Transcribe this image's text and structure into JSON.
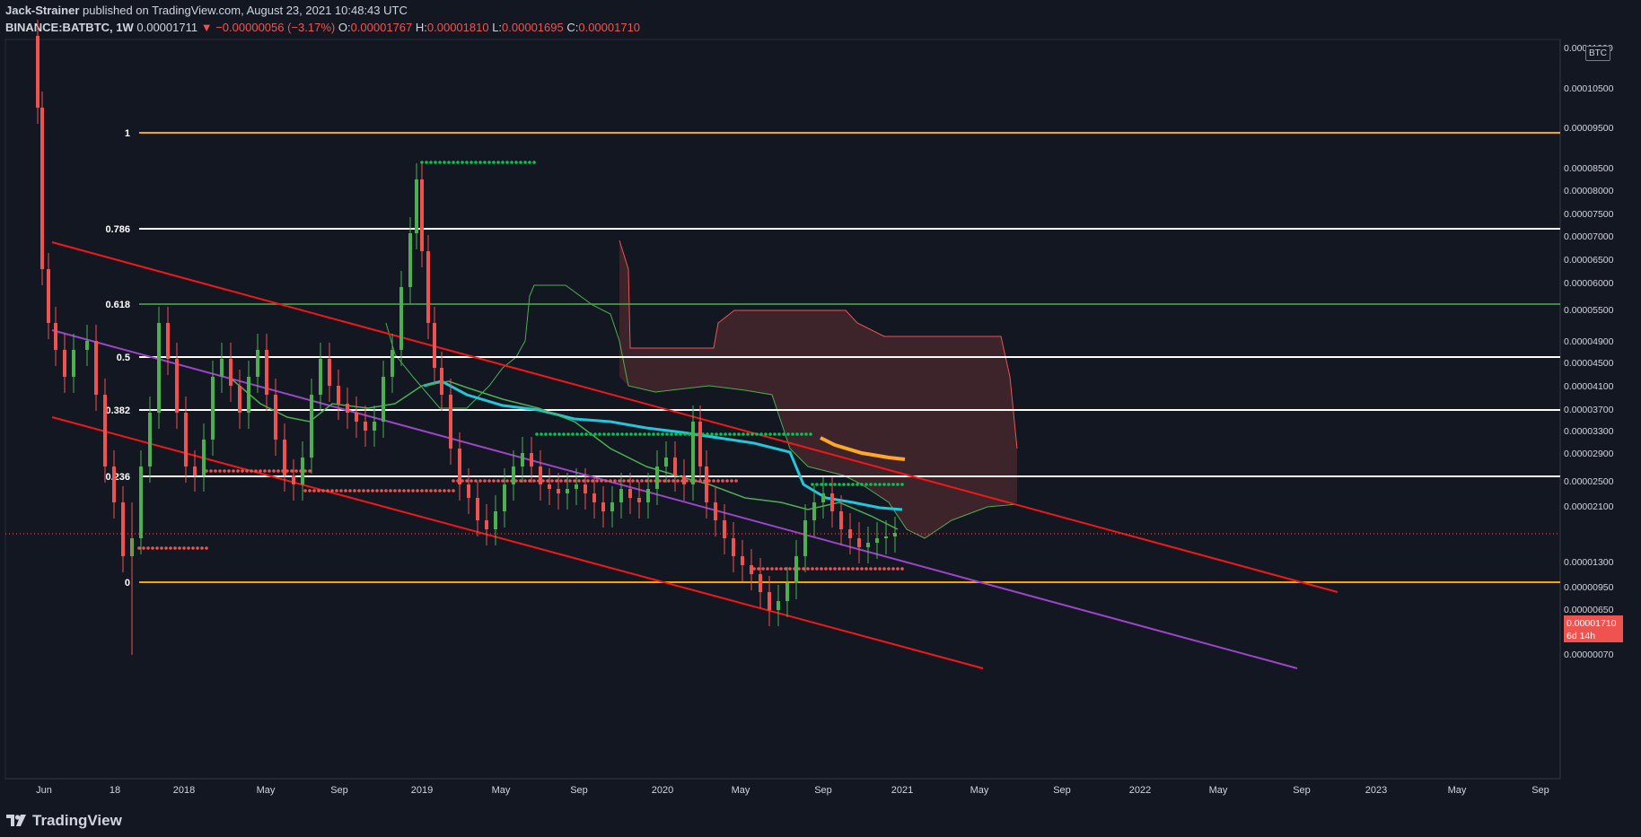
{
  "header": {
    "publisher": "Jack-Strainer",
    "published_text": "published on TradingView.com, August 23, 2021 10:48:43 UTC",
    "symbol": "BINANCE:BATBTC, 1W",
    "last": "0.00001711",
    "change": "−0.00000056 (−3.17%)",
    "o_label": "O:",
    "o_value": "0.00001767",
    "h_label": "H:",
    "h_value": "0.00001810",
    "l_label": "L:",
    "l_value": "0.00001695",
    "c_label": "C:",
    "c_value": "0.00001710"
  },
  "unit_label": "BTC",
  "price_tag": {
    "price": "0.00001710",
    "countdown": "6d 14h"
  },
  "footer": {
    "brand": "TradingView"
  },
  "colors": {
    "background": "#131722",
    "bull": "#4caf50",
    "bear": "#ef5350",
    "fib_gold": "#f7a600",
    "fib_white": "#ffffff",
    "fib_green": "#4caf50",
    "channel": "#f21818",
    "midline": "#9c45c8",
    "ma_blue": "#26c6da",
    "ma_orange": "#ffa726",
    "cloud": "#8b3a3a"
  },
  "chart_data": {
    "type": "candlestick",
    "symbol": "BINANCE:BATBTC",
    "interval": "1W",
    "y_scale": "log",
    "x_ticks": [
      "Jun",
      "18",
      "2018",
      "May",
      "Sep",
      "2019",
      "May",
      "Sep",
      "2020",
      "May",
      "Sep",
      "2021",
      "May",
      "Sep",
      "2022",
      "May",
      "Sep",
      "2023",
      "May",
      "Sep"
    ],
    "y_ticks": [
      "0.00011000",
      "0.00010500",
      "0.00009500",
      "0.00008500",
      "0.00008000",
      "0.00007500",
      "0.00007000",
      "0.00006500",
      "0.00006000",
      "0.00005500",
      "0.00004900",
      "0.00004500",
      "0.00004100",
      "0.00003700",
      "0.00003300",
      "0.00002900",
      "0.00002500",
      "0.00002100",
      "0.00001710",
      "0.00001300",
      "0.00000950",
      "0.00000650",
      "0.00000350",
      "0.00000070"
    ],
    "fib_levels": [
      {
        "label": "1",
        "color": "#f7a600"
      },
      {
        "label": "0.786",
        "color": "#ffffff"
      },
      {
        "label": "0.618",
        "color": "#4caf50"
      },
      {
        "label": "0.5",
        "color": "#ffffff"
      },
      {
        "label": "0.382",
        "color": "#ffffff"
      },
      {
        "label": "0.236",
        "color": "#ffffff"
      },
      {
        "label": "0",
        "color": "#f7a600"
      }
    ],
    "last_price": "0.00001710"
  }
}
